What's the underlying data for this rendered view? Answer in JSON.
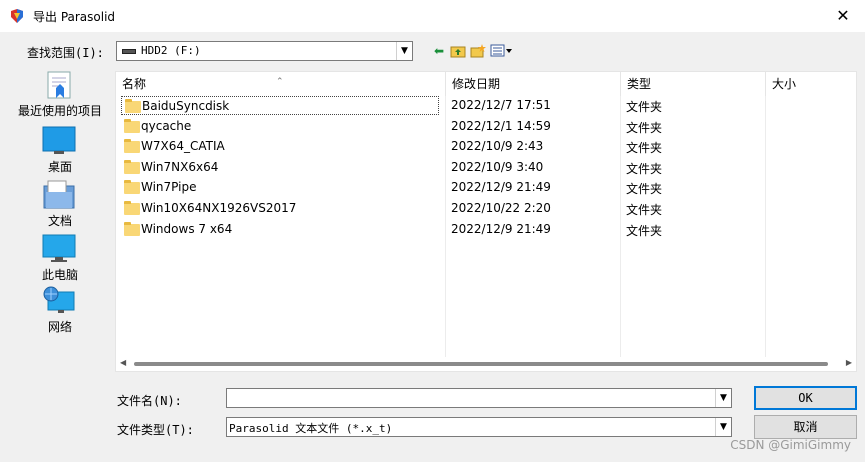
{
  "window": {
    "title": "导出 Parasolid",
    "close_glyph": "✕",
    "app_icon": "parasolid-app-icon"
  },
  "lookin": {
    "label": "查找范围(I):",
    "value": "HDD2 (F:)",
    "drive_icon": "drive-icon",
    "arrow": "▼"
  },
  "toolbar": {
    "back_glyph": "⬅",
    "up_glyph": "⬆",
    "newfolder_glyph": "✱",
    "view_glyph": "▦▾"
  },
  "places": [
    {
      "label": "最近使用的项目",
      "icon": "recent-items-icon"
    },
    {
      "label": "桌面",
      "icon": "desktop-icon"
    },
    {
      "label": "文档",
      "icon": "documents-icon"
    },
    {
      "label": "此电脑",
      "icon": "this-pc-icon"
    },
    {
      "label": "网络",
      "icon": "network-icon"
    }
  ],
  "columns": [
    "名称",
    "修改日期",
    "类型",
    "大小"
  ],
  "files": [
    {
      "name": "BaiduSyncdisk",
      "date": "2022/12/7 17:51",
      "type": "文件夹",
      "size": ""
    },
    {
      "name": "qycache",
      "date": "2022/12/1 14:59",
      "type": "文件夹",
      "size": ""
    },
    {
      "name": "W7X64_CATIA",
      "date": "2022/10/9 2:43",
      "type": "文件夹",
      "size": ""
    },
    {
      "name": "Win7NX6x64",
      "date": "2022/10/9 3:40",
      "type": "文件夹",
      "size": ""
    },
    {
      "name": "Win7Pipe",
      "date": "2022/12/9 21:49",
      "type": "文件夹",
      "size": ""
    },
    {
      "name": "Win10X64NX1926VS2017",
      "date": "2022/10/22 2:20",
      "type": "文件夹",
      "size": ""
    },
    {
      "name": "Windows 7 x64",
      "date": "2022/12/9 21:49",
      "type": "文件夹",
      "size": ""
    }
  ],
  "filename": {
    "label": "文件名(N):",
    "value": ""
  },
  "filetype": {
    "label": "文件类型(T):",
    "value": "Parasolid 文本文件 (*.x_t)"
  },
  "buttons": {
    "ok": "OK",
    "cancel": "取消"
  },
  "watermark": "CSDN @GimiGimmy"
}
